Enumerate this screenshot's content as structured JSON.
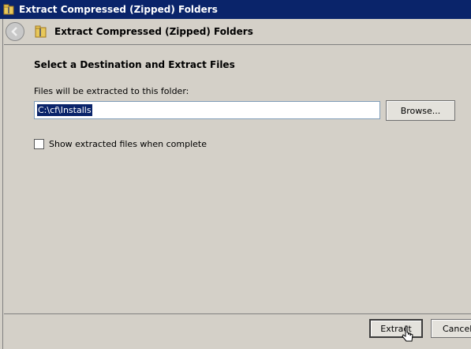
{
  "window": {
    "title": "Extract Compressed (Zipped) Folders",
    "icon": "zip-folder-icon"
  },
  "header": {
    "back_icon": "back-arrow-icon",
    "title": "Extract Compressed (Zipped) Folders"
  },
  "main": {
    "section_title": "Select a Destination and Extract Files",
    "destination_label": "Files will be extracted to this folder:",
    "destination_value": "C:\\cf\\Installs",
    "browse_label": "Browse...",
    "show_files_label": "Show extracted files when complete",
    "show_files_checked": false
  },
  "footer": {
    "extract_label": "Extract",
    "cancel_label": "Cancel"
  },
  "colors": {
    "titlebar": "#0a246a",
    "selection": "#0a246a",
    "dialog_bg": "#d4d0c8"
  }
}
